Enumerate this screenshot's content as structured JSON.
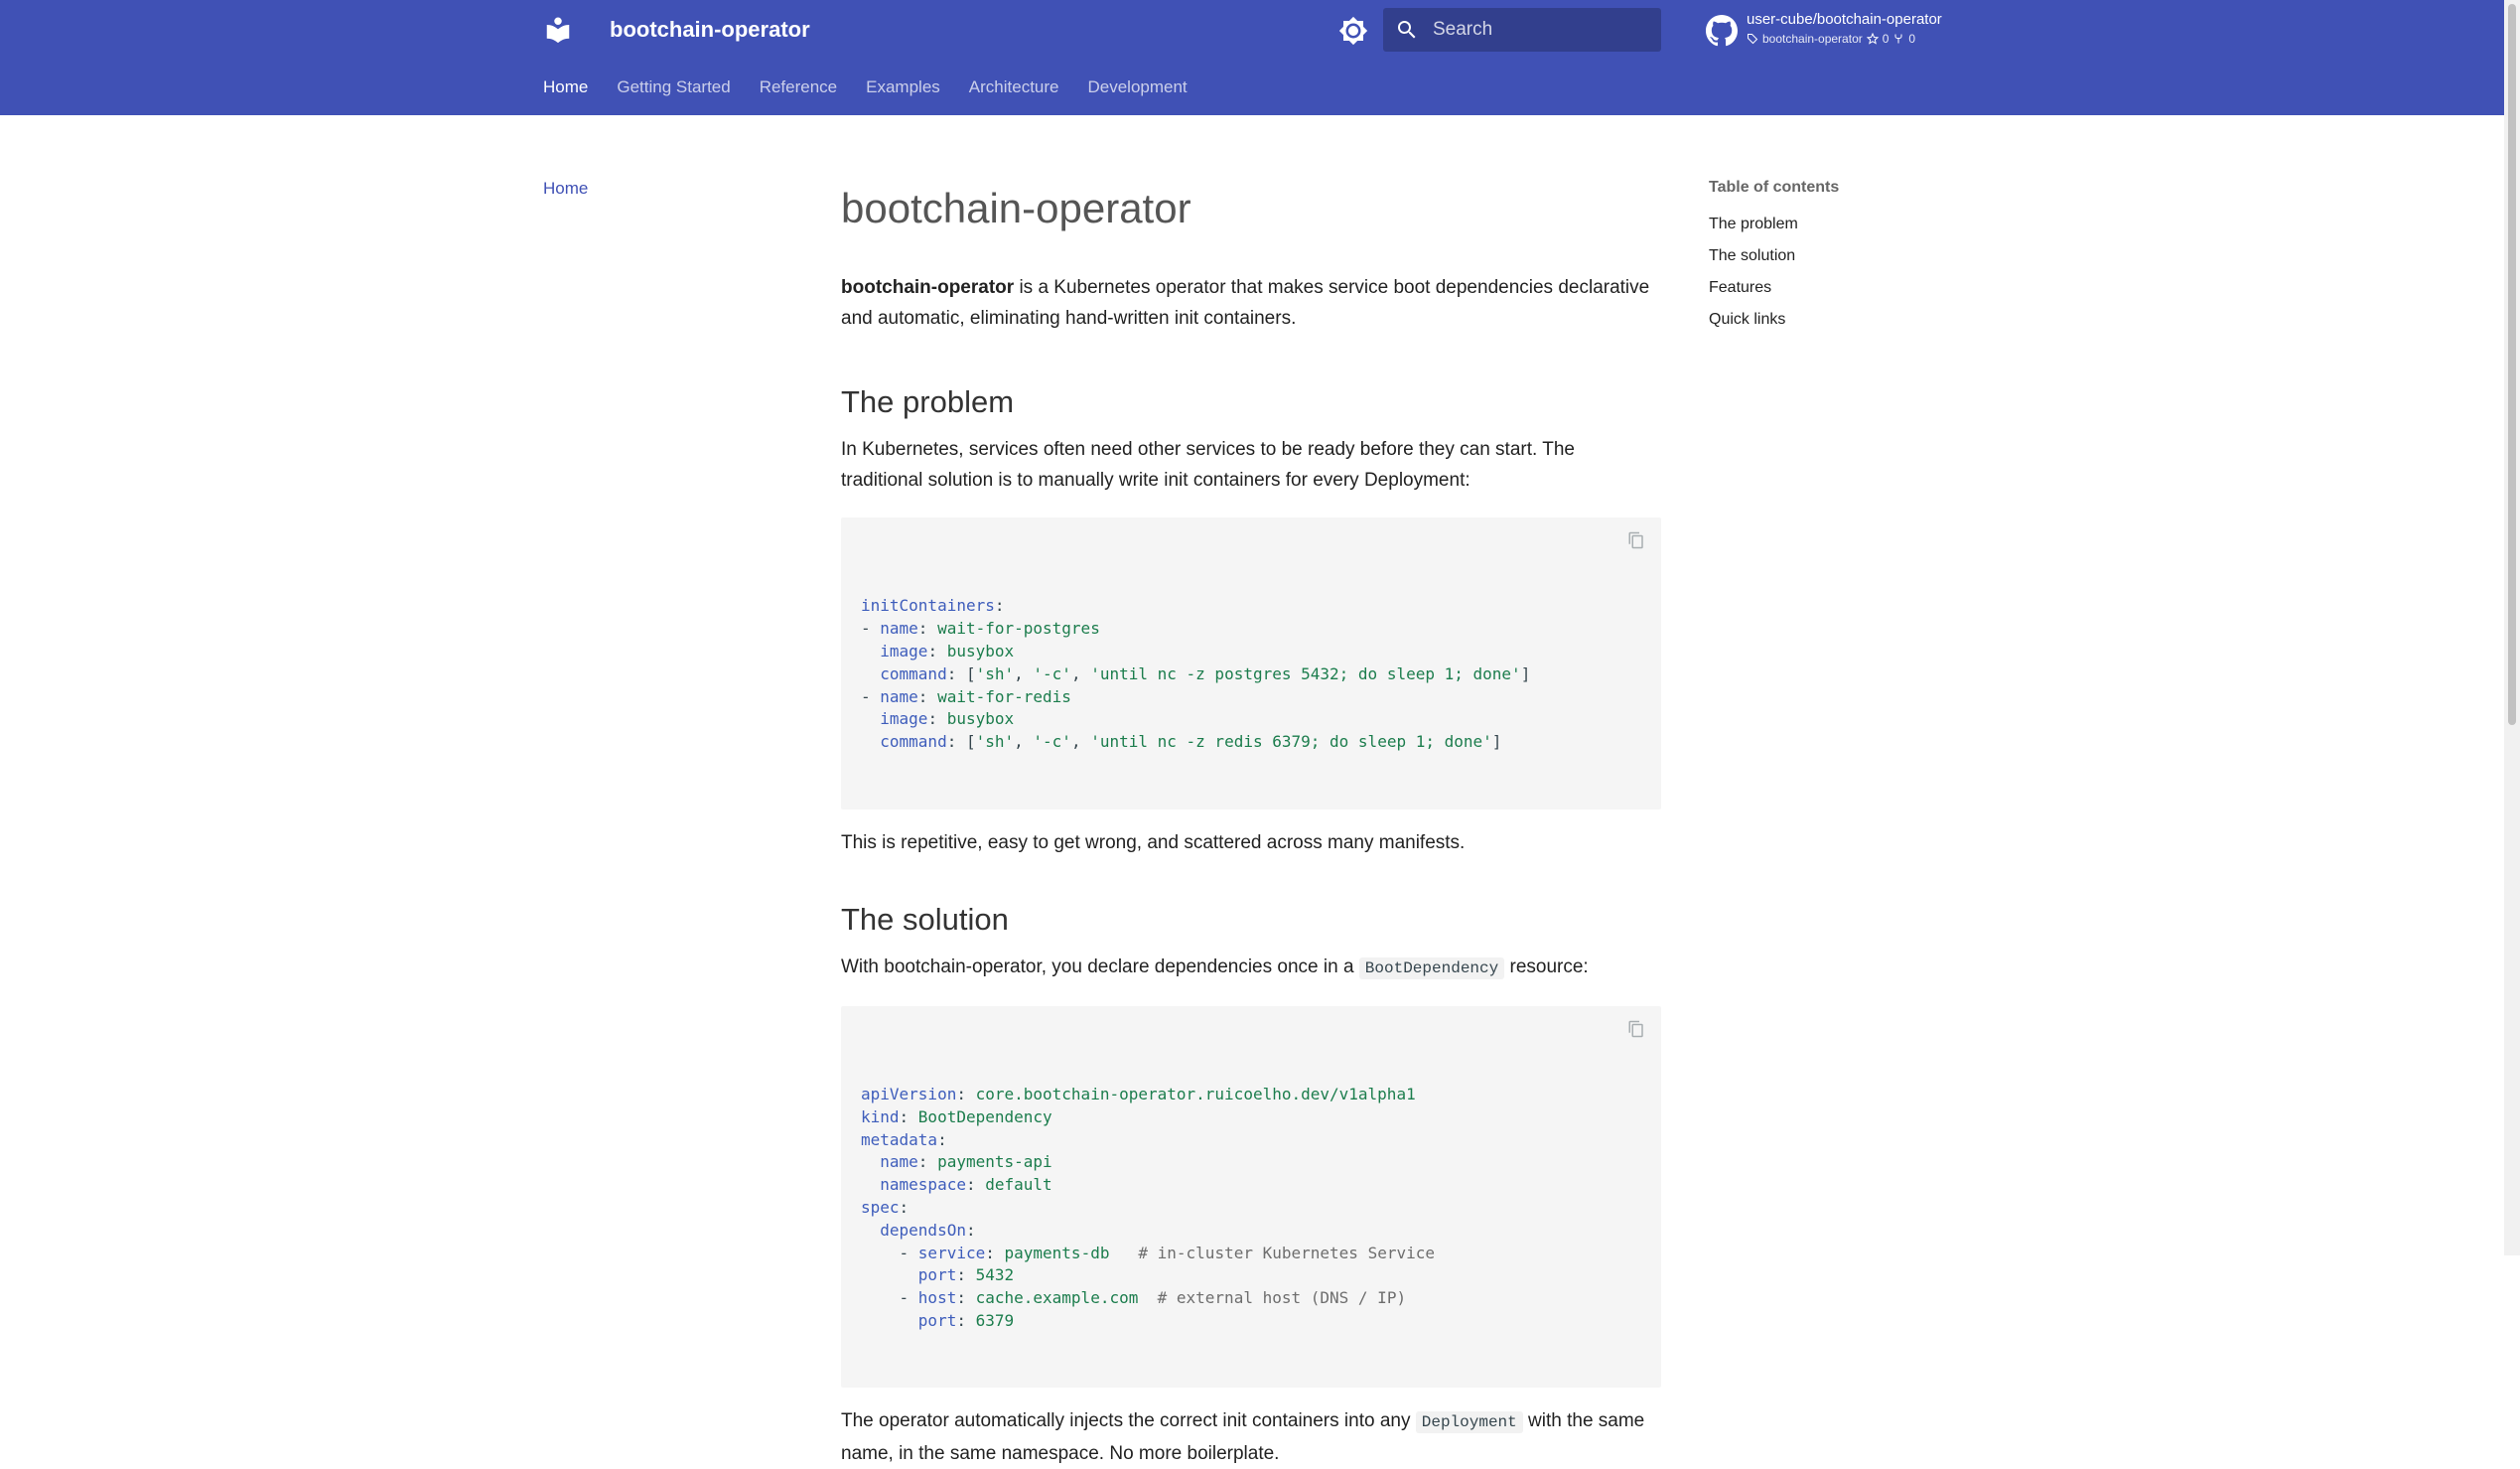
{
  "header": {
    "title": "bootchain-operator",
    "search": {
      "placeholder": "Search"
    },
    "repo": {
      "name": "user-cube/bootchain-operator",
      "version": "bootchain-operator",
      "stars": "0",
      "forks": "0"
    },
    "tabs": [
      {
        "label": "Home"
      },
      {
        "label": "Getting Started"
      },
      {
        "label": "Reference"
      },
      {
        "label": "Examples"
      },
      {
        "label": "Architecture"
      },
      {
        "label": "Development"
      }
    ]
  },
  "sidebar": {
    "home": "Home"
  },
  "content": {
    "title": "bootchain-operator",
    "intro_bold": "bootchain-operator",
    "intro_rest": " is a Kubernetes operator that makes service boot dependencies declarative and automatic, eliminating hand-written init containers.",
    "problem_heading": "The problem",
    "problem_text": "In Kubernetes, services often need other services to be ready before they can start. The traditional solution is to manually write init containers for every Deployment:",
    "problem_after": "This is repetitive, easy to get wrong, and scattered across many manifests.",
    "solution_heading": "The solution",
    "solution_text_before": "With bootchain-operator, you declare dependencies once in a ",
    "solution_code": "BootDependency",
    "solution_text_after": " resource:",
    "operator_text_before": "The operator automatically injects the correct init containers into any ",
    "operator_code": "Deployment",
    "operator_text_after": " with the same name, in the same namespace. No more boilerplate."
  },
  "code1": [
    [
      [
        "k",
        "initContainers"
      ],
      [
        "p",
        ":"
      ]
    ],
    [
      [
        "p",
        "- "
      ],
      [
        "k",
        "name"
      ],
      [
        "p",
        ": "
      ],
      [
        "s",
        "wait-for-postgres"
      ]
    ],
    [
      [
        "p",
        "  "
      ],
      [
        "k",
        "image"
      ],
      [
        "p",
        ": "
      ],
      [
        "s",
        "busybox"
      ]
    ],
    [
      [
        "p",
        "  "
      ],
      [
        "k",
        "command"
      ],
      [
        "p",
        ": ["
      ],
      [
        "s",
        "'sh'"
      ],
      [
        "p",
        ", "
      ],
      [
        "s",
        "'-c'"
      ],
      [
        "p",
        ", "
      ],
      [
        "s",
        "'until nc -z postgres 5432; do sleep 1; done'"
      ],
      [
        "p",
        "]"
      ]
    ],
    [
      [
        "p",
        "- "
      ],
      [
        "k",
        "name"
      ],
      [
        "p",
        ": "
      ],
      [
        "s",
        "wait-for-redis"
      ]
    ],
    [
      [
        "p",
        "  "
      ],
      [
        "k",
        "image"
      ],
      [
        "p",
        ": "
      ],
      [
        "s",
        "busybox"
      ]
    ],
    [
      [
        "p",
        "  "
      ],
      [
        "k",
        "command"
      ],
      [
        "p",
        ": ["
      ],
      [
        "s",
        "'sh'"
      ],
      [
        "p",
        ", "
      ],
      [
        "s",
        "'-c'"
      ],
      [
        "p",
        ", "
      ],
      [
        "s",
        "'until nc -z redis 6379; do sleep 1; done'"
      ],
      [
        "p",
        "]"
      ]
    ]
  ],
  "code2": [
    [
      [
        "k",
        "apiVersion"
      ],
      [
        "p",
        ": "
      ],
      [
        "s",
        "core.bootchain-operator.ruicoelho.dev/v1alpha1"
      ]
    ],
    [
      [
        "k",
        "kind"
      ],
      [
        "p",
        ": "
      ],
      [
        "s",
        "BootDependency"
      ]
    ],
    [
      [
        "k",
        "metadata"
      ],
      [
        "p",
        ":"
      ]
    ],
    [
      [
        "p",
        "  "
      ],
      [
        "k",
        "name"
      ],
      [
        "p",
        ": "
      ],
      [
        "s",
        "payments-api"
      ]
    ],
    [
      [
        "p",
        "  "
      ],
      [
        "k",
        "namespace"
      ],
      [
        "p",
        ": "
      ],
      [
        "s",
        "default"
      ]
    ],
    [
      [
        "k",
        "spec"
      ],
      [
        "p",
        ":"
      ]
    ],
    [
      [
        "p",
        "  "
      ],
      [
        "k",
        "dependsOn"
      ],
      [
        "p",
        ":"
      ]
    ],
    [
      [
        "p",
        "    - "
      ],
      [
        "k",
        "service"
      ],
      [
        "p",
        ": "
      ],
      [
        "s",
        "payments-db"
      ],
      [
        "p",
        "   "
      ],
      [
        "c",
        "# in-cluster Kubernetes Service"
      ]
    ],
    [
      [
        "p",
        "      "
      ],
      [
        "k",
        "port"
      ],
      [
        "p",
        ": "
      ],
      [
        "n",
        "5432"
      ]
    ],
    [
      [
        "p",
        "    - "
      ],
      [
        "k",
        "host"
      ],
      [
        "p",
        ": "
      ],
      [
        "s",
        "cache.example.com"
      ],
      [
        "p",
        "  "
      ],
      [
        "c",
        "# external host (DNS / IP)"
      ]
    ],
    [
      [
        "p",
        "      "
      ],
      [
        "k",
        "port"
      ],
      [
        "p",
        ": "
      ],
      [
        "n",
        "6379"
      ]
    ]
  ],
  "toc": {
    "title": "Table of contents",
    "items": [
      {
        "label": "The problem"
      },
      {
        "label": "The solution"
      },
      {
        "label": "Features"
      },
      {
        "label": "Quick links"
      }
    ]
  }
}
